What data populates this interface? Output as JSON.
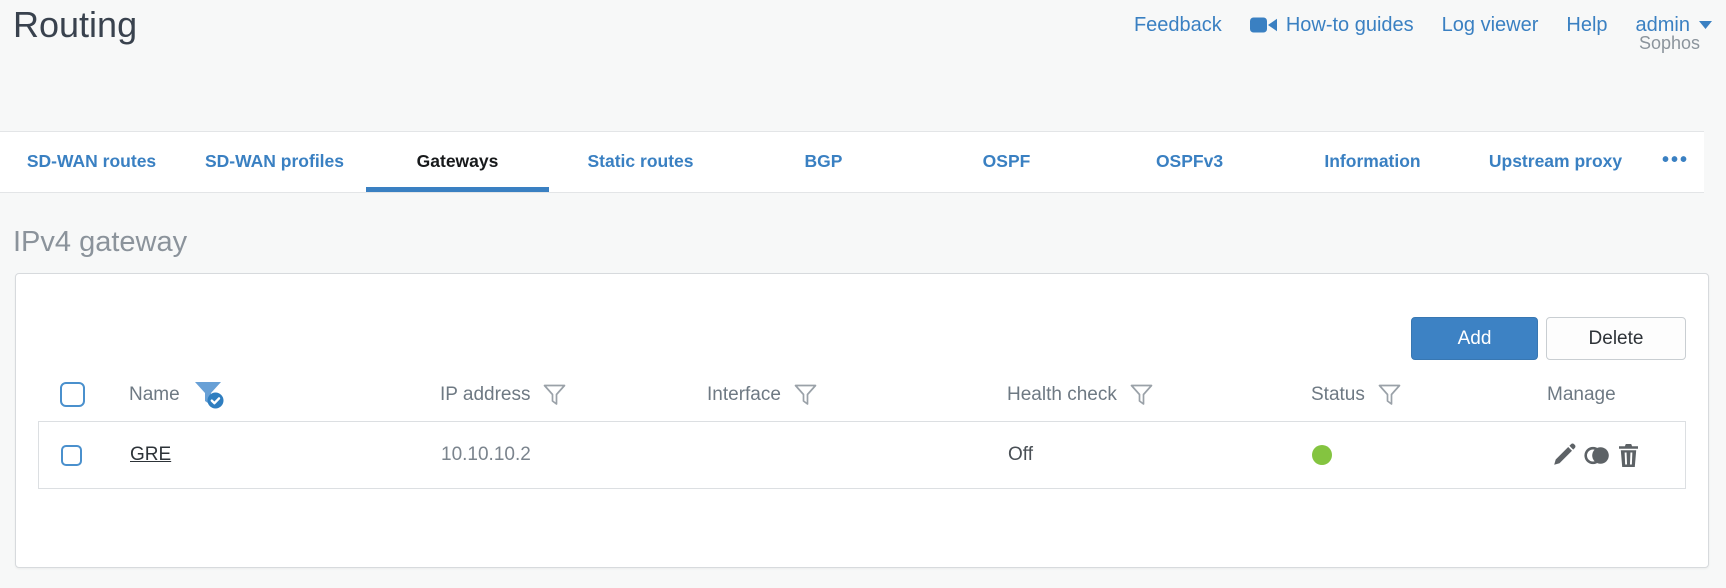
{
  "header": {
    "title": "Routing",
    "nav": {
      "feedback": "Feedback",
      "howto": "How-to guides",
      "log_viewer": "Log viewer",
      "help": "Help",
      "user": "admin",
      "brand": "Sophos"
    }
  },
  "tabs": {
    "items": [
      {
        "label": "SD-WAN routes",
        "active": false
      },
      {
        "label": "SD-WAN profiles",
        "active": false
      },
      {
        "label": "Gateways",
        "active": true
      },
      {
        "label": "Static routes",
        "active": false
      },
      {
        "label": "BGP",
        "active": false
      },
      {
        "label": "OSPF",
        "active": false
      },
      {
        "label": "OSPFv3",
        "active": false
      },
      {
        "label": "Information",
        "active": false
      },
      {
        "label": "Upstream proxy",
        "active": false
      }
    ],
    "more": "•••"
  },
  "section": {
    "heading": "IPv4 gateway"
  },
  "toolbar": {
    "add_label": "Add",
    "delete_label": "Delete"
  },
  "table": {
    "columns": [
      {
        "label": "Name",
        "filter": "active"
      },
      {
        "label": "IP address",
        "filter": "default"
      },
      {
        "label": "Interface",
        "filter": "default"
      },
      {
        "label": "Health check",
        "filter": "default"
      },
      {
        "label": "Status",
        "filter": "default"
      },
      {
        "label": "Manage",
        "filter": "none"
      }
    ],
    "rows": [
      {
        "name": "GRE",
        "ip_address": "10.10.10.2",
        "interface": "",
        "health_check": "Off",
        "status": "green"
      }
    ]
  },
  "icons": {
    "howto": "video-camera-icon",
    "user_caret": "chevron-down-icon",
    "name_filter": "filter-funnel-checked-icon",
    "filter": "filter-funnel-icon",
    "edit": "pencil-icon",
    "clone": "clone-icon",
    "delete": "trash-icon"
  },
  "colors": {
    "accent_blue": "#3a80c2",
    "button_blue": "#3d82c4",
    "status_green": "#84c440",
    "title_dark": "#39424e",
    "muted_gray": "#8b939b"
  }
}
